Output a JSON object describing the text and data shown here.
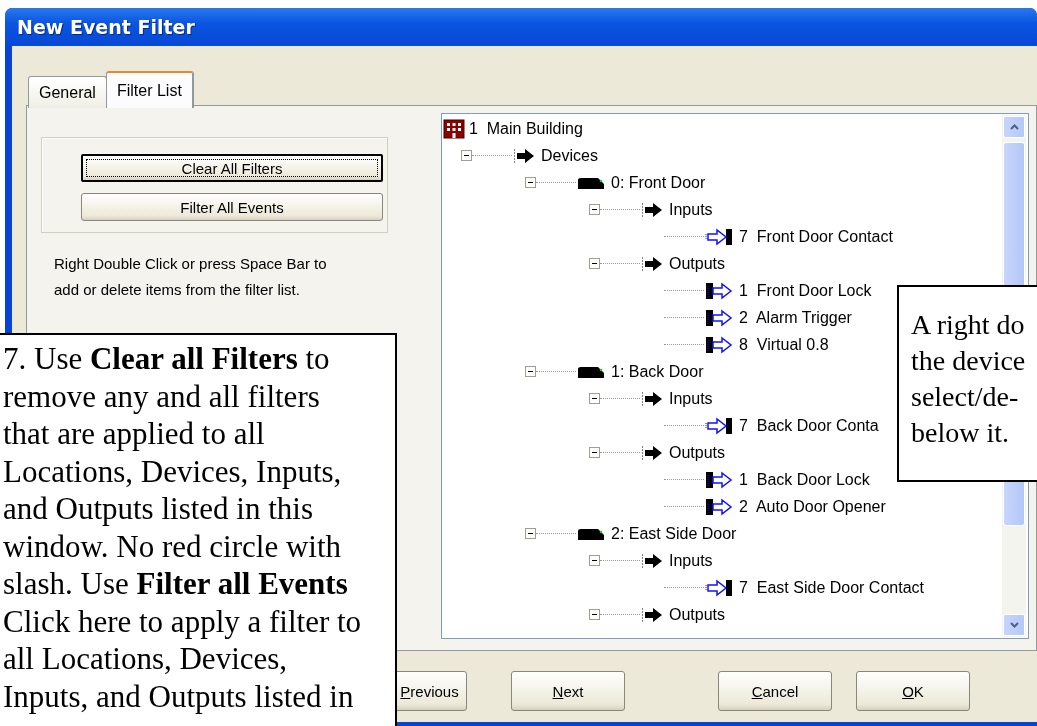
{
  "window": {
    "title": "New Event Filter"
  },
  "tabs": [
    {
      "label": "General",
      "selected": false
    },
    {
      "label": "Filter List",
      "selected": true
    }
  ],
  "filter_buttons": [
    {
      "label": "Clear All Filters",
      "focused": true
    },
    {
      "label": "Filter All Events",
      "focused": false
    }
  ],
  "help_text": "Right Double Click or press Space Bar to add or delete items from the filter list.",
  "tree": {
    "kind": "site",
    "label": "1  Main Building",
    "children": [
      {
        "kind": "folder",
        "label": "Devices",
        "expanded": true,
        "children": [
          {
            "kind": "device",
            "label": "0: Front Door",
            "expanded": true,
            "children": [
              {
                "kind": "folder",
                "label": "Inputs",
                "expanded": true,
                "children": [
                  {
                    "kind": "input",
                    "label": "7  Front Door Contact"
                  }
                ]
              },
              {
                "kind": "folder",
                "label": "Outputs",
                "expanded": true,
                "children": [
                  {
                    "kind": "output",
                    "label": "1  Front Door Lock"
                  },
                  {
                    "kind": "output",
                    "label": "2  Alarm Trigger"
                  },
                  {
                    "kind": "output",
                    "label": "8  Virtual 0.8"
                  }
                ]
              }
            ]
          },
          {
            "kind": "device",
            "label": "1: Back Door",
            "expanded": true,
            "children": [
              {
                "kind": "folder",
                "label": "Inputs",
                "expanded": true,
                "children": [
                  {
                    "kind": "input",
                    "label": "7  Back Door Conta"
                  }
                ]
              },
              {
                "kind": "folder",
                "label": "Outputs",
                "expanded": true,
                "children": [
                  {
                    "kind": "output",
                    "label": "1  Back Door Lock"
                  },
                  {
                    "kind": "output",
                    "label": "2  Auto Door Opener"
                  }
                ]
              }
            ]
          },
          {
            "kind": "device",
            "label": "2: East Side Door",
            "expanded": true,
            "children": [
              {
                "kind": "folder",
                "label": "Inputs",
                "expanded": true,
                "children": [
                  {
                    "kind": "input",
                    "label": "7  East Side Door Contact"
                  }
                ]
              },
              {
                "kind": "folder",
                "label": "Outputs",
                "expanded": true
              }
            ]
          }
        ]
      }
    ]
  },
  "footer_buttons": [
    {
      "label": "Previous"
    },
    {
      "label": "Next"
    },
    {
      "label": "Cancel"
    },
    {
      "label": "OK"
    }
  ],
  "callouts": [
    {
      "text": "7. Use **Clear all Filters** to remove any and all filters that are applied to all Locations, Devices, Inputs, and Outputs listed in this window. No red circle with slash. Use **Filter all Events** Click here to apply a filter to all Locations, Devices, Inputs, and Outputs listed in"
    },
    {
      "text": "A right do the device select/de- below it."
    }
  ]
}
